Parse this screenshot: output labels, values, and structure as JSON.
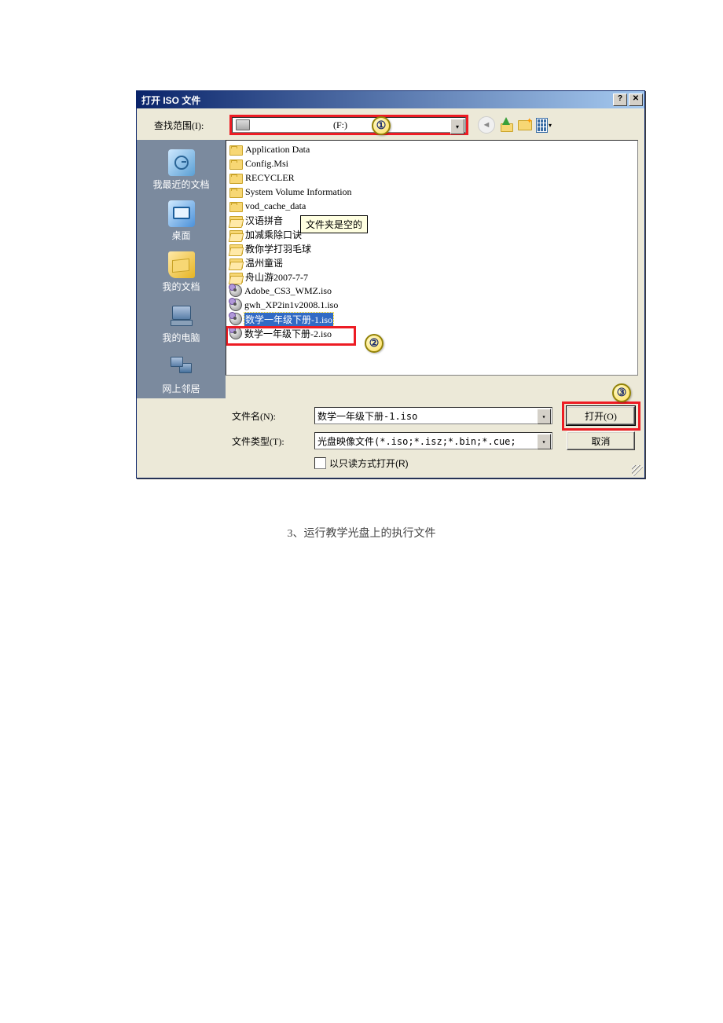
{
  "titlebar": {
    "title": "打开 ISO 文件"
  },
  "toprow": {
    "lookin_label": "查找范围(I):",
    "drive_label": "(F:)"
  },
  "places": {
    "recent": "我最近的文档",
    "desktop": "桌面",
    "mydocs": "我的文档",
    "mycomputer": "我的电脑",
    "network": "网上邻居"
  },
  "files": [
    {
      "type": "folder-closed",
      "name": "Application Data"
    },
    {
      "type": "folder-closed",
      "name": "Config.Msi"
    },
    {
      "type": "folder-closed",
      "name": "RECYCLER"
    },
    {
      "type": "folder-closed",
      "name": "System Volume Information"
    },
    {
      "type": "folder-closed",
      "name": "vod_cache_data"
    },
    {
      "type": "folder-open",
      "name": "汉语拼音"
    },
    {
      "type": "folder-open",
      "name": "加减乘除口诀"
    },
    {
      "type": "folder-open",
      "name": "教你学打羽毛球"
    },
    {
      "type": "folder-open",
      "name": "温州童谣"
    },
    {
      "type": "folder-open",
      "name": "舟山游2007-7-7"
    },
    {
      "type": "iso",
      "name": "Adobe_CS3_WMZ.iso"
    },
    {
      "type": "iso",
      "name": "gwh_XP2in1v2008.1.iso"
    },
    {
      "type": "iso",
      "name": "数学一年级下册-1.iso",
      "selected": true
    },
    {
      "type": "iso",
      "name": "数学一年级下册-2.iso"
    }
  ],
  "tooltip": "文件夹是空的",
  "bottom": {
    "fname_label": "文件名(N):",
    "fname_value": "数学一年级下册-1.iso",
    "ftype_label": "文件类型(T):",
    "ftype_value": "光盘映像文件(*.iso;*.isz;*.bin;*.cue;*.nrg;*.mdf;*.img)",
    "open_btn": "打开(O)",
    "cancel_btn": "取消",
    "readonly_label": "以只读方式打开(R)"
  },
  "callouts": {
    "one": "①",
    "two": "②",
    "three": "③"
  },
  "caption": "3、运行教学光盘上的执行文件"
}
